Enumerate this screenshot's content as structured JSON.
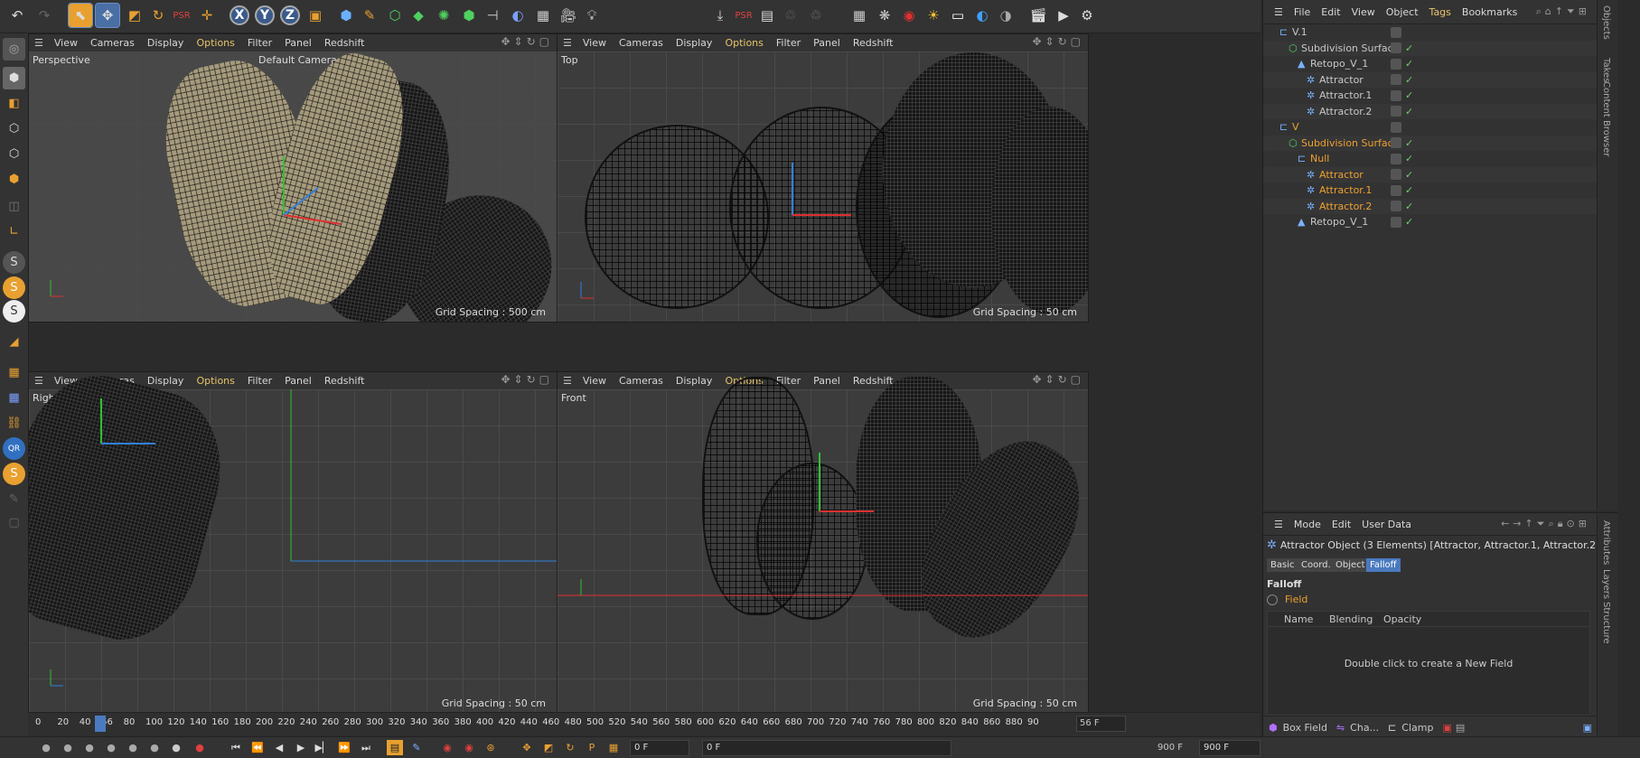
{
  "viewports": [
    {
      "name": "Perspective",
      "camera": "Default Camera",
      "grid_spacing": "Grid Spacing : 500 cm"
    },
    {
      "name": "Top",
      "grid_spacing": "Grid Spacing : 50 cm"
    },
    {
      "name": "Right",
      "grid_spacing": "Grid Spacing : 50 cm"
    },
    {
      "name": "Front",
      "grid_spacing": "Grid Spacing : 50 cm"
    }
  ],
  "viewport_menu": {
    "view": "View",
    "cameras": "Cameras",
    "display": "Display",
    "options": "Options",
    "filter": "Filter",
    "panel": "Panel",
    "redshift": "Redshift"
  },
  "object_manager": {
    "menu": {
      "file": "File",
      "edit": "Edit",
      "view": "View",
      "object": "Object",
      "tags": "Tags",
      "bookmarks": "Bookmarks"
    },
    "objects": [
      {
        "name": "V.1",
        "indent": 0,
        "color": "normal"
      },
      {
        "name": "Subdivision Surface",
        "indent": 1,
        "color": "normal"
      },
      {
        "name": "Retopo_V_1",
        "indent": 2,
        "color": "normal"
      },
      {
        "name": "Attractor",
        "indent": 3,
        "color": "normal"
      },
      {
        "name": "Attractor.1",
        "indent": 3,
        "color": "normal"
      },
      {
        "name": "Attractor.2",
        "indent": 3,
        "color": "normal"
      },
      {
        "name": "V",
        "indent": 0,
        "color": "orange"
      },
      {
        "name": "Subdivision Surface",
        "indent": 1,
        "color": "orange"
      },
      {
        "name": "Null",
        "indent": 2,
        "color": "orange"
      },
      {
        "name": "Attractor",
        "indent": 3,
        "color": "orange"
      },
      {
        "name": "Attractor.1",
        "indent": 3,
        "color": "orange"
      },
      {
        "name": "Attractor.2",
        "indent": 3,
        "color": "orange"
      },
      {
        "name": "Retopo_V_1",
        "indent": 2,
        "color": "normal"
      }
    ],
    "side_tabs": [
      "Objects",
      "Takes",
      "Content Browser"
    ]
  },
  "attribute_manager": {
    "menu": {
      "mode": "Mode",
      "edit": "Edit",
      "user_data": "User Data"
    },
    "title": "Attractor Object (3 Elements) [Attractor, Attractor.1, Attractor.2]",
    "tabs": [
      "Basic",
      "Coord.",
      "Object",
      "Falloff"
    ],
    "active_tab": "Falloff",
    "section": "Falloff",
    "field_label": "Field",
    "columns": [
      "Name",
      "Blending",
      "Opacity"
    ],
    "empty_hint": "Double click to create a New Field",
    "bottom_buttons": [
      "Box Field",
      "Cha...",
      "Clamp"
    ],
    "side_tabs": [
      "Attributes",
      "Layers",
      "Structure"
    ]
  },
  "timeline": {
    "ticks": [
      "0",
      "20",
      "40",
      "56",
      "80",
      "100",
      "120",
      "140",
      "160",
      "180",
      "200",
      "220",
      "240",
      "260",
      "280",
      "300",
      "320",
      "340",
      "360",
      "380",
      "400",
      "420",
      "440",
      "460",
      "480",
      "500",
      "520",
      "540",
      "560",
      "580",
      "600",
      "620",
      "640",
      "660",
      "680",
      "700",
      "720",
      "740",
      "760",
      "780",
      "800",
      "820",
      "840",
      "860",
      "880",
      "90"
    ],
    "current_frame": "56 F",
    "current_marker": "56"
  },
  "playback": {
    "start": "0 F",
    "range_start": "0 F",
    "range_end": "900 F",
    "end": "900 F"
  },
  "colors": {
    "accent": "#4a7ac0",
    "options_yellow": "#e8c46a",
    "orange": "#f0a030",
    "x_axis": "#e03030",
    "y_axis": "#30c030",
    "z_axis": "#3080e0"
  }
}
